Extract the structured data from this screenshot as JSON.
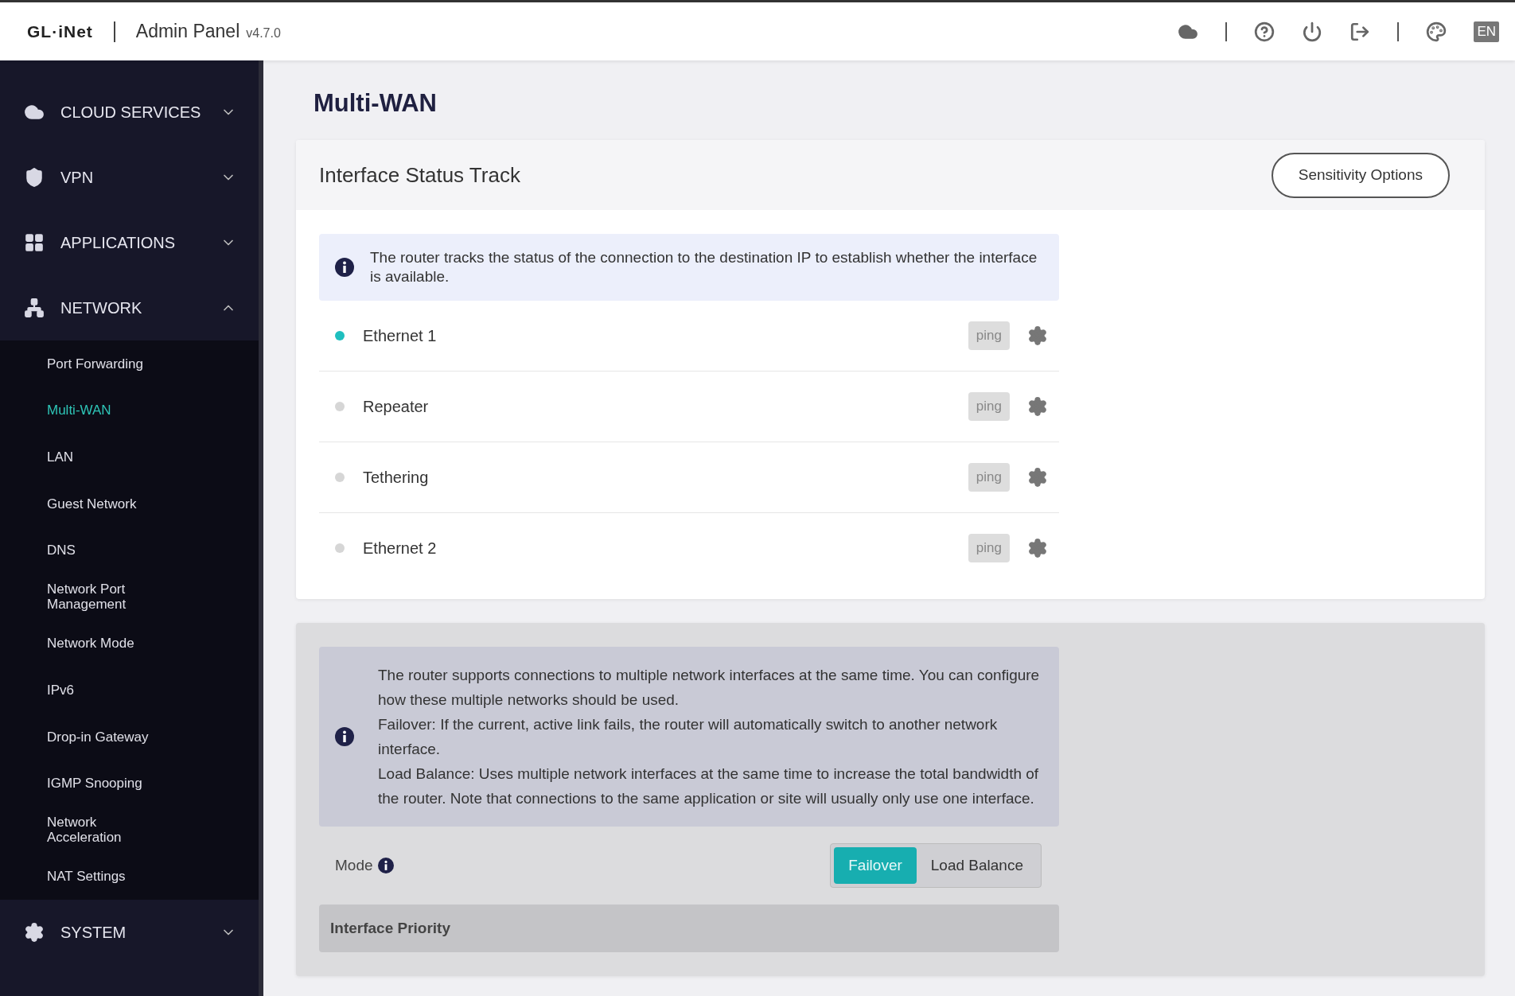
{
  "header": {
    "logo": "GL·iNet",
    "title": "Admin Panel",
    "version": "v4.7.0",
    "language": "EN"
  },
  "sidebar": {
    "groups": [
      {
        "kind": "cloud",
        "label": "CLOUD SERVICES",
        "expanded": false
      },
      {
        "kind": "vpn",
        "label": "VPN",
        "expanded": false
      },
      {
        "kind": "applications",
        "label": "APPLICATIONS",
        "expanded": false
      },
      {
        "kind": "network",
        "label": "NETWORK",
        "expanded": true,
        "children": [
          {
            "label": "Port Forwarding",
            "selected": false
          },
          {
            "label": "Multi-WAN",
            "selected": true
          },
          {
            "label": "LAN",
            "selected": false
          },
          {
            "label": "Guest Network",
            "selected": false
          },
          {
            "label": "DNS",
            "selected": false
          },
          {
            "label": "Network Port Management",
            "selected": false
          },
          {
            "label": "Network Mode",
            "selected": false
          },
          {
            "label": "IPv6",
            "selected": false
          },
          {
            "label": "Drop-in Gateway",
            "selected": false
          },
          {
            "label": "IGMP Snooping",
            "selected": false
          },
          {
            "label": "Network Acceleration",
            "selected": false
          },
          {
            "label": "NAT Settings",
            "selected": false
          }
        ]
      },
      {
        "kind": "system",
        "label": "SYSTEM",
        "expanded": false
      }
    ]
  },
  "page": {
    "title": "Multi-WAN"
  },
  "status_track": {
    "title": "Interface Status Track",
    "button": "Sensitivity Options",
    "info": "The router tracks the status of the connection to the destination IP to establish whether the interface is available.",
    "interfaces": [
      {
        "name": "Ethernet 1",
        "online": true,
        "method": "ping"
      },
      {
        "name": "Repeater",
        "online": false,
        "method": "ping"
      },
      {
        "name": "Tethering",
        "online": false,
        "method": "ping"
      },
      {
        "name": "Ethernet 2",
        "online": false,
        "method": "ping"
      }
    ]
  },
  "mode_card": {
    "info": [
      "The router supports connections to multiple network interfaces at the same time. You can configure how these multiple networks should be used.",
      "Failover: If the current, active link fails, the router will automatically switch to another network interface.",
      "Load Balance: Uses multiple network interfaces at the same time to increase the total bandwidth of the router. Note that connections to the same application or site will usually only use one interface."
    ],
    "mode_label": "Mode",
    "modes": [
      {
        "label": "Failover",
        "selected": true
      },
      {
        "label": "Load Balance",
        "selected": false
      }
    ],
    "priority_title": "Interface Priority"
  }
}
